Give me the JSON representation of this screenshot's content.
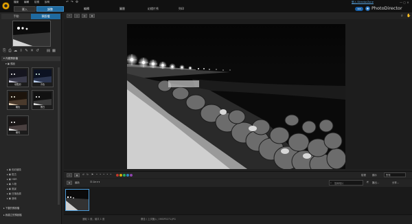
{
  "app": {
    "name": "PhotoDirector",
    "badge": "365",
    "login": "登入 DirectorZone"
  },
  "menu": [
    "檔案",
    "編輯",
    "檢視",
    "說明"
  ],
  "quick_actions": [
    "↶",
    "↷",
    "⚙"
  ],
  "modules": [
    {
      "label": "匯入"
    },
    {
      "label": "調整",
      "active": true
    },
    {
      "label": "編輯"
    },
    {
      "label": "圖層"
    },
    {
      "label": "幻燈片秀"
    },
    {
      "label": "列印"
    }
  ],
  "left_panel": {
    "tabs": [
      "手動",
      "預設檔"
    ],
    "preset_header": "內建預設檔",
    "group_default": "預設",
    "thumbs": [
      "增豔彩",
      "冷色",
      "暖色",
      "黑白",
      "曝光"
    ],
    "groups": [
      "色彩變換",
      "復古",
      "HDR",
      "人物",
      "風景",
      "日落色調",
      "藝術"
    ],
    "downloaded": "下載的預設檔",
    "my_presets": "我建立的預設檔"
  },
  "filmstrip": {
    "sort": "最新",
    "display_label": "顯示",
    "display_value": "所有",
    "search_placeholder": "搜尋相片",
    "export": "匯出...",
    "share": "分享...",
    "view_label": "檢視"
  },
  "status": {
    "text": "選取 1 張，總共 1 張",
    "file": "廣告 / 上次匯入 / IMGP0271.JPG"
  },
  "colors": {
    "accent": "#1f6aa0",
    "link": "#5aa7e3",
    "logo": "#e2a100",
    "label_red": "#c0392b",
    "label_yellow": "#d4ac0d",
    "label_green": "#27ae60",
    "label_blue": "#2e86c1",
    "label_purple": "#8e44ad"
  }
}
